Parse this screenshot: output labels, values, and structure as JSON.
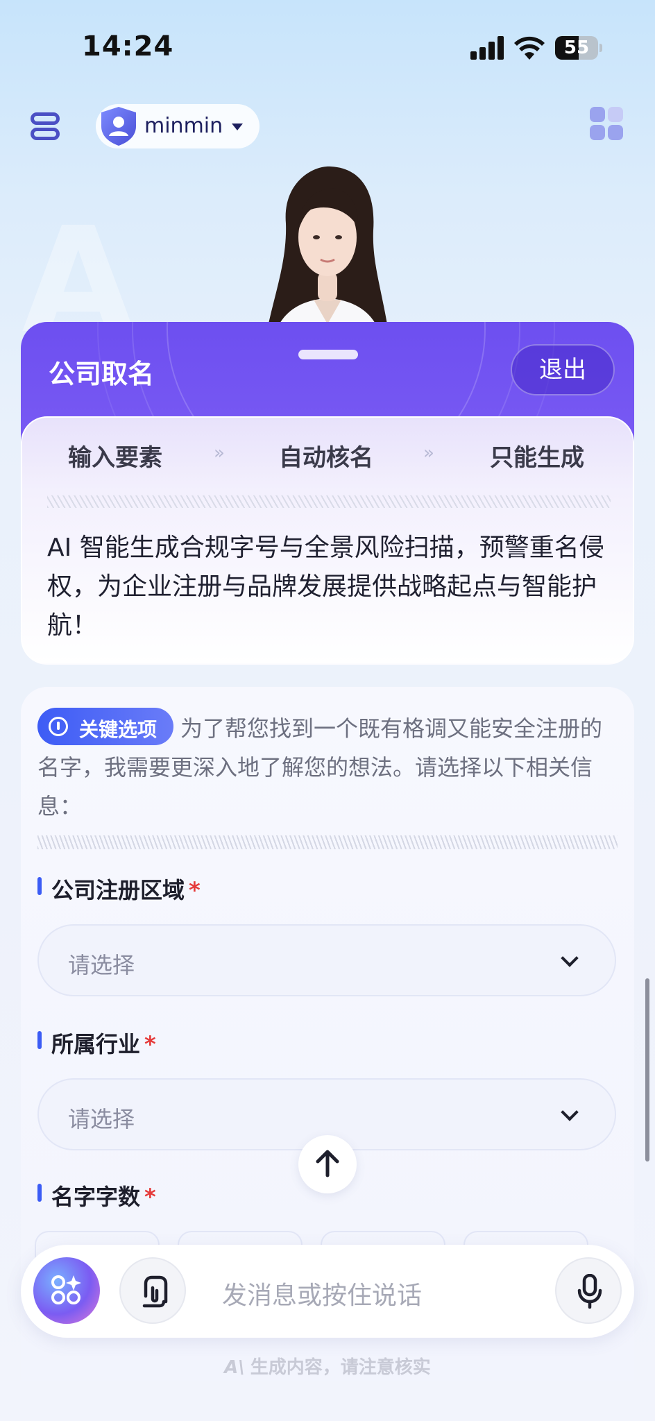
{
  "status_bar": {
    "time": "14:24",
    "battery": "55",
    "battery_level": 0.55
  },
  "header": {
    "username": "minmin"
  },
  "title_card": {
    "title": "公司取名",
    "exit_label": "退出"
  },
  "steps": [
    "输入要素",
    "自动核名",
    "只能生成"
  ],
  "step_separator": "»",
  "intro": {
    "text": "AI 智能生成合规字号与全景风险扫描，预警重名侵权，为企业注册与品牌发展提供战略起点与智能护航！"
  },
  "prompt": {
    "badge": "关键选项",
    "text": "为了帮您找到一个既有格调又能安全注册的名字，我需要更深入地了解您的想法。请选择以下相关信息："
  },
  "form": {
    "fields": [
      {
        "label": "公司注册区域",
        "required": "*",
        "value": "请选择"
      },
      {
        "label": "所属行业",
        "required": "*",
        "value": "请选择"
      },
      {
        "label": "名字字数",
        "required": "*"
      }
    ]
  },
  "input_bar": {
    "placeholder": "发消息或按住说话"
  },
  "footer": {
    "ai_mark": "A\\",
    "disclaimer": "生成内容，请注意核实"
  },
  "colors": {
    "accent": "#3b5cf5",
    "title_gradient_start": "#6d4ff0",
    "required": "#e53b3b"
  }
}
